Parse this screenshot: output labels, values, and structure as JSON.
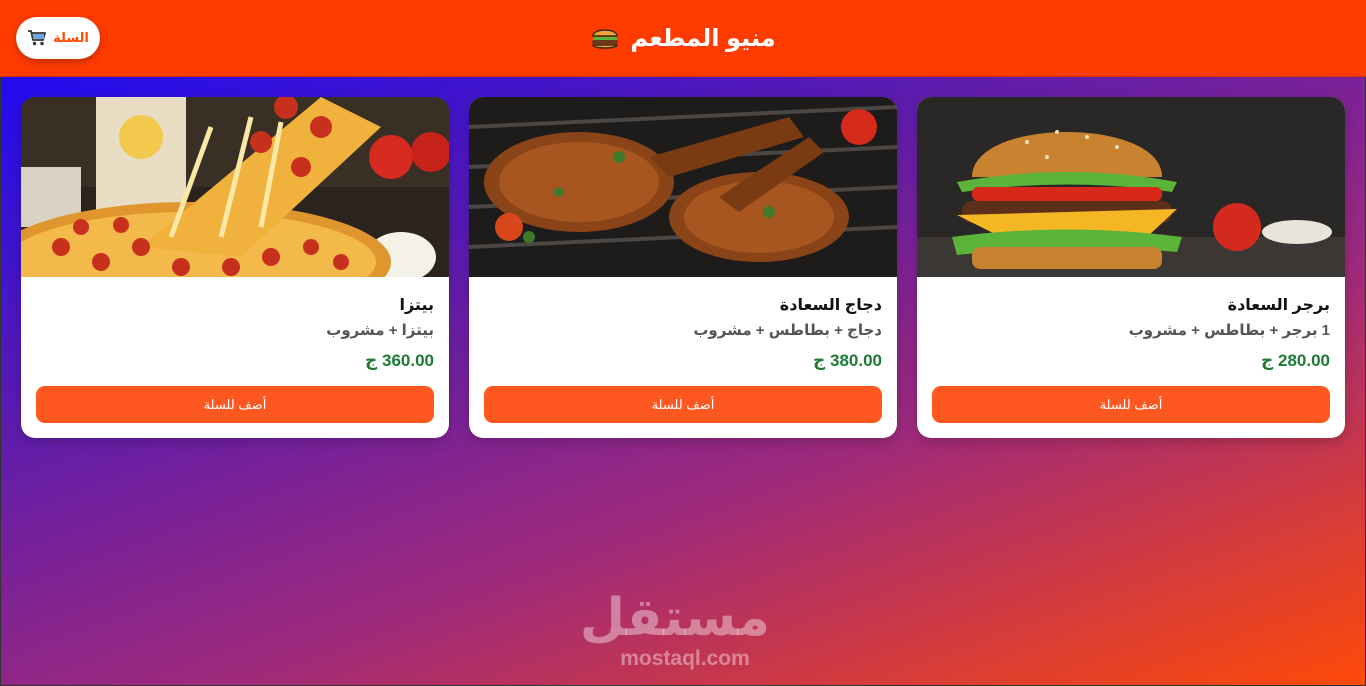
{
  "header": {
    "title": "منيو المطعم",
    "cart_label": "السلة",
    "cart_icon": "shopping-cart-icon",
    "title_icon": "burger-icon",
    "bg_color": "#ff3b00"
  },
  "menu": [
    {
      "name": "بيتزا",
      "description": "بيتزا + مشروب",
      "price": "360.00 ج",
      "button": "أضف للسلة"
    },
    {
      "name": "دجاج السعادة",
      "description": "دجاج + بطاطس + مشروب",
      "price": "380.00 ج",
      "button": "أضف للسلة"
    },
    {
      "name": "برجر السعادة",
      "description": "1 برجر + بطاطس + مشروب",
      "price": "280.00 ج",
      "button": "أضف للسلة"
    }
  ],
  "watermark": {
    "arabic": "مستقل",
    "english": "mostaql.com"
  },
  "colors": {
    "accent": "#ff5720",
    "price": "#1e7a35"
  }
}
